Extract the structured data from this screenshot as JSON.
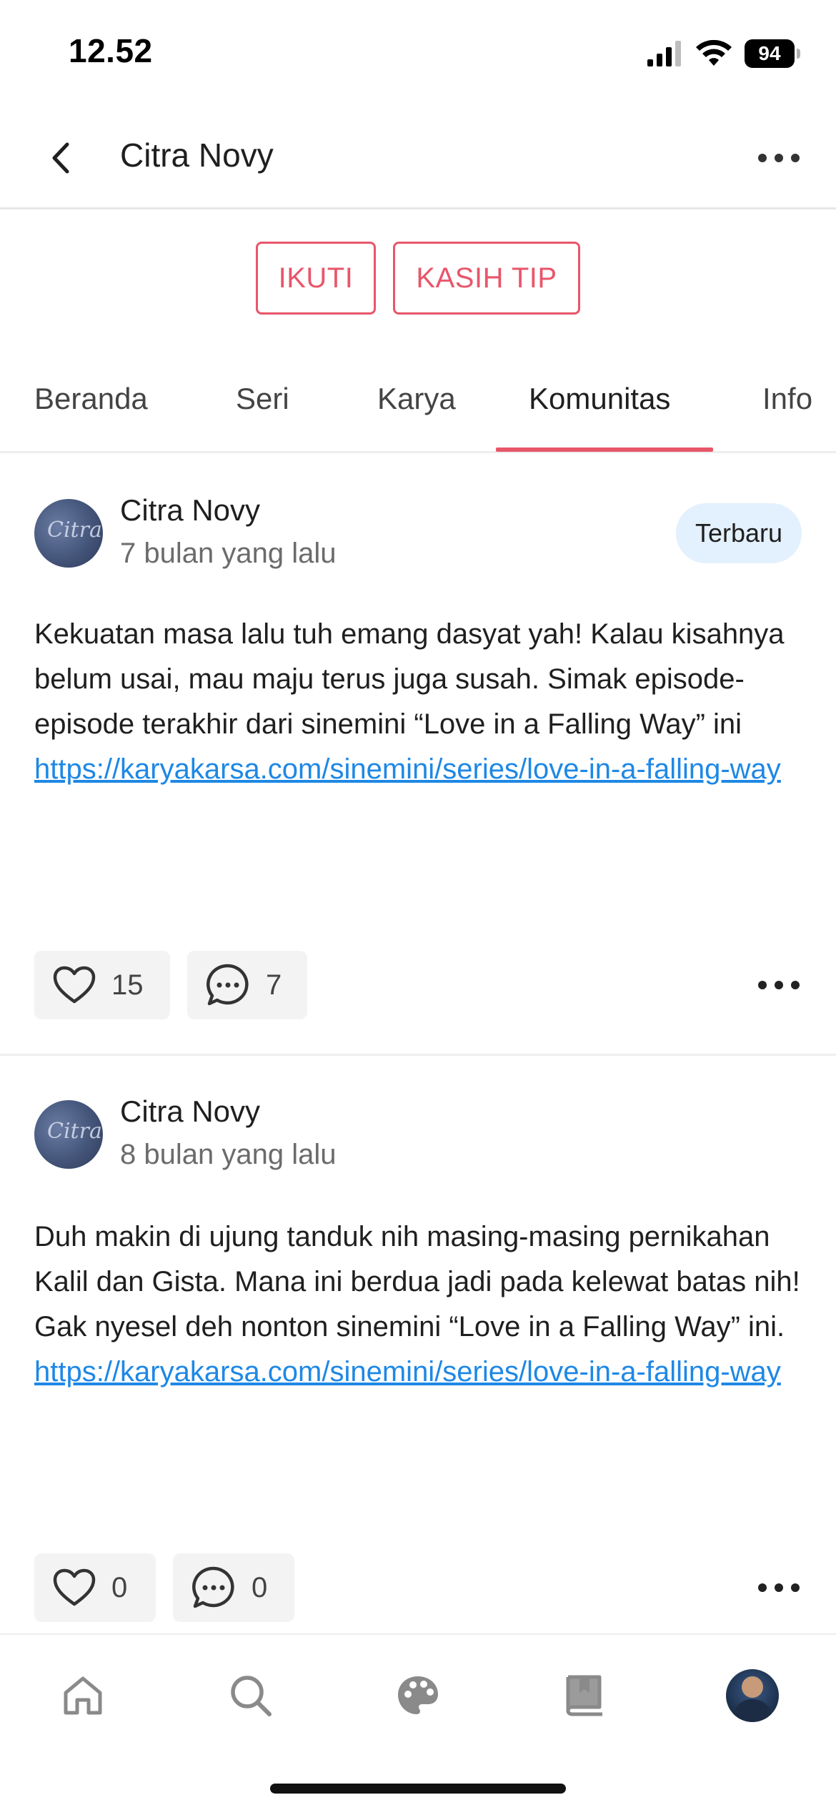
{
  "status_bar": {
    "time": "12.52",
    "battery": "94",
    "icons": [
      "signal-icon",
      "wifi-icon",
      "battery-icon"
    ]
  },
  "header": {
    "back_icon": "chevron-left-icon",
    "title": "Citra Novy",
    "more_icon": "more-horizontal-icon"
  },
  "actions": {
    "follow_label": "IKUTI",
    "tip_label": "KASIH TIP"
  },
  "tabs": [
    {
      "label": "Beranda",
      "active": false
    },
    {
      "label": "Seri",
      "active": false
    },
    {
      "label": "Karya",
      "active": false
    },
    {
      "label": "Komunitas",
      "active": true
    },
    {
      "label": "Info",
      "active": false
    }
  ],
  "posts": [
    {
      "author": "Citra Novy",
      "time": "7 bulan yang lalu",
      "badge": "Terbaru",
      "body": "Kekuatan masa lalu tuh emang dasyat yah! Kalau kisahnya belum usai, mau maju terus juga susah. Simak episode-episode terakhir dari  sinemini “Love in a Falling Way” ini",
      "link": "https://karyakarsa.com/sinemini/series/love-in-a-falling-way",
      "likes": "15",
      "comments": "7"
    },
    {
      "author": "Citra Novy",
      "time": "8 bulan yang lalu",
      "body": "Duh makin di ujung tanduk nih masing-masing pernikahan Kalil dan Gista. Mana ini berdua jadi pada kelewat batas nih! Gak nyesel deh nonton sinemini “Love in a Falling Way” ini.",
      "link": "https://karyakarsa.com/sinemini/series/love-in-a-falling-way",
      "likes": "0",
      "comments": "0"
    }
  ],
  "bottom_nav": {
    "items": [
      "home-icon",
      "search-icon",
      "palette-icon",
      "library-icon",
      "profile-avatar"
    ]
  },
  "colors": {
    "accent": "#e8566a",
    "link": "#1e88e5",
    "badge_bg": "#e3f0fd",
    "pill_bg": "#f3f3f3"
  }
}
